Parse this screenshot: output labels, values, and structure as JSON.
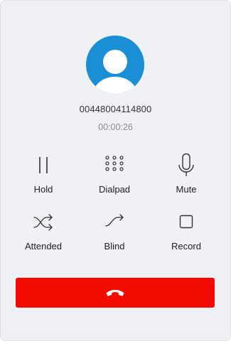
{
  "call": {
    "number": "00448004114800",
    "duration": "00:00:26"
  },
  "controls": [
    {
      "label": "Hold",
      "icon": "pause-icon"
    },
    {
      "label": "Dialpad",
      "icon": "dialpad-icon"
    },
    {
      "label": "Mute",
      "icon": "microphone-icon"
    },
    {
      "label": "Attended",
      "icon": "shuffle-icon"
    },
    {
      "label": "Blind",
      "icon": "forward-arrow-icon"
    },
    {
      "label": "Record",
      "icon": "record-square-icon"
    }
  ],
  "hangup": {
    "icon": "end-call-icon",
    "color": "#f20a00"
  },
  "colors": {
    "avatar": "#1a8fd6",
    "background": "#f0f1f4"
  }
}
